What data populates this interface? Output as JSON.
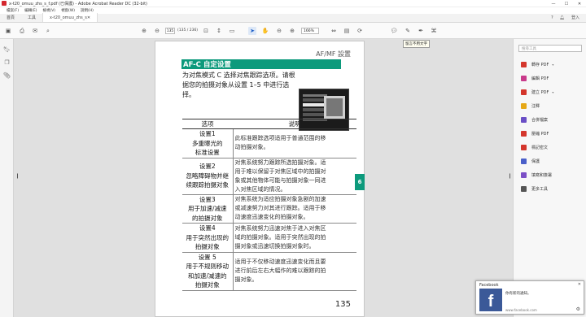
{
  "window": {
    "title": "x-t20_omuu_zhs_s_f.pdf (已保護) - Adobe Acrobat Reader DC (32-bit)",
    "controls": [
      "—",
      "☐",
      "✕"
    ]
  },
  "menu": [
    "檔案(F)",
    "編輯(E)",
    "檢視(V)",
    "視窗(W)",
    "說明(H)"
  ],
  "tabs": {
    "home": "首頁",
    "tools": "工具",
    "doc": "x-t20_omuu_zhs_s_f.pdf",
    "doc_close": "✕",
    "help": "?",
    "signin": "登入"
  },
  "toolbar": {
    "page_current": "135",
    "page_count": "(135 / 236)",
    "zoom": "166%",
    "tooltip": "留言不用文字"
  },
  "document": {
    "header": "AF/MF 設置",
    "section_title": "AF-C 自定设置",
    "intro": "为对焦模式 C 选择对焦跟踪选项。请根据您的拍摄对象从设置 1–5 中进行选择。",
    "side_tab": "6",
    "table": {
      "headers": [
        "选项",
        "说明"
      ],
      "rows": [
        {
          "option": [
            "设置1",
            "多重曝光的",
            "标准设置"
          ],
          "desc": [
            "此标准跟踪选项适用于普通范围的移",
            "动拍摄对象。"
          ]
        },
        {
          "option": [
            "设置2",
            "忽略障碍物并继",
            "续跟踪拍摄对象"
          ],
          "desc": [
            "对焦系统努力跟踪所选拍摄对象。适",
            "用于难以保留于对焦区域中的拍摄对",
            "象或其他物体可能与拍摄对象一同进",
            "入对焦区域的情况。"
          ]
        },
        {
          "option": [
            "设置3",
            "用于加速/减速",
            "的拍摄对象"
          ],
          "desc": [
            "对焦系统为适应拍摄对象急剧的加速",
            "或减速努力对其进行跟踪。适用于移",
            "动速度迅速变化的拍摄对象。"
          ]
        },
        {
          "option": [
            "设置4",
            "用于突然出现的",
            "拍摄对象"
          ],
          "desc": [
            "对焦系统努力迅速对焦于进入对焦区",
            "域的拍摄对象。适用于突然出现的拍",
            "摄对象或迅速切换拍摄对象时。"
          ]
        },
        {
          "option": [
            "设置 5",
            "用于不规则移动",
            "和加速/减速的",
            "拍摄对象"
          ],
          "desc": [
            "适用于不仅移动速度迅速变化而且要",
            "进行前后左右大幅作的难以跟踪的拍",
            "摄对象。"
          ]
        }
      ]
    },
    "page_number": "135"
  },
  "rightpane": {
    "search_placeholder": "搜尋工具",
    "tools": [
      {
        "label": "轉存 PDF",
        "color": "#d4362c",
        "chevron": true
      },
      {
        "label": "編輯 PDF",
        "color": "#c93a8b",
        "chevron": false
      },
      {
        "label": "建立 PDF",
        "color": "#d4362c",
        "chevron": true
      },
      {
        "label": "注釋",
        "color": "#e6a817",
        "chevron": false
      },
      {
        "label": "合併檔案",
        "color": "#6a4fc6",
        "chevron": false
      },
      {
        "label": "壓縮 PDF",
        "color": "#d4362c",
        "chevron": false
      },
      {
        "label": "標記密文",
        "color": "#d4362c",
        "chevron": false
      },
      {
        "label": "保護",
        "color": "#4a5fc9",
        "chevron": false
      },
      {
        "label": "填寫和簽署",
        "color": "#7b4fc6",
        "chevron": false
      },
      {
        "label": "更多工具",
        "color": "#555555",
        "chevron": false
      }
    ]
  },
  "toast": {
    "app": "Facebook",
    "message": "你有新的通知。",
    "source": "www.facebook.com",
    "logo": "f",
    "close": "✕",
    "gear": "⚙"
  }
}
